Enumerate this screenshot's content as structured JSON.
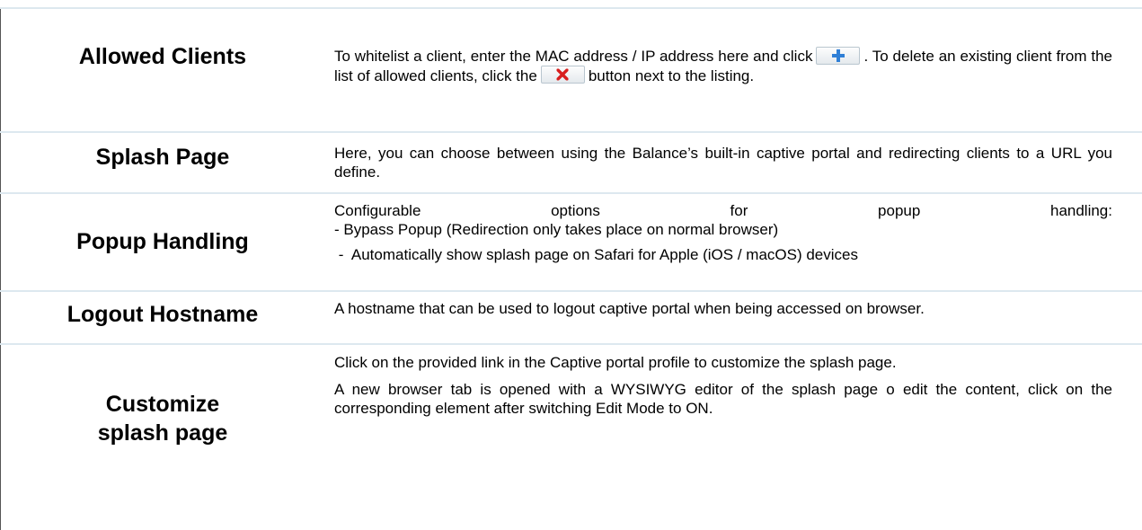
{
  "rows": {
    "allowed_clients": {
      "label": "Allowed Clients",
      "desc_part1": "To whitelist a client, enter the MAC address / IP address here and click",
      "desc_part2": ". To delete an existing client from the list of allowed clients, click the",
      "desc_part3": "button next to the listing.",
      "icons": [
        "plus-icon",
        "red-x-icon"
      ]
    },
    "splash_page": {
      "label": "Splash Page",
      "desc": "Here, you can choose between using the Balance’s built-in captive portal and redirecting clients to a URL you define."
    },
    "popup_handling": {
      "label": "Popup Handling",
      "line1_words": [
        "Configurable",
        "options",
        "for",
        "popup",
        "handling:"
      ],
      "line2": "- Bypass Popup (Redirection only takes place on normal browser)",
      "line3": " -  Automatically show splash page on Safari for Apple (iOS / macOS) devices"
    },
    "logout_hostname": {
      "label": "Logout Hostname",
      "desc": "A hostname that can be used to logout captive portal when being accessed on browser."
    },
    "customize_splash": {
      "label_line1": "Customize",
      "label_line2": "splash page",
      "para1": "Click on the provided link in the Captive portal profile to customize the splash page.",
      "para2": "A new browser tab is opened with a WYSIWYG editor of the splash page o edit the content, click on the corresponding element after switching Edit Mode to ON."
    }
  },
  "colors": {
    "divider": "#dde8ef",
    "plus_icon": "#2f7fd6",
    "x_icon": "#d81e1e"
  }
}
